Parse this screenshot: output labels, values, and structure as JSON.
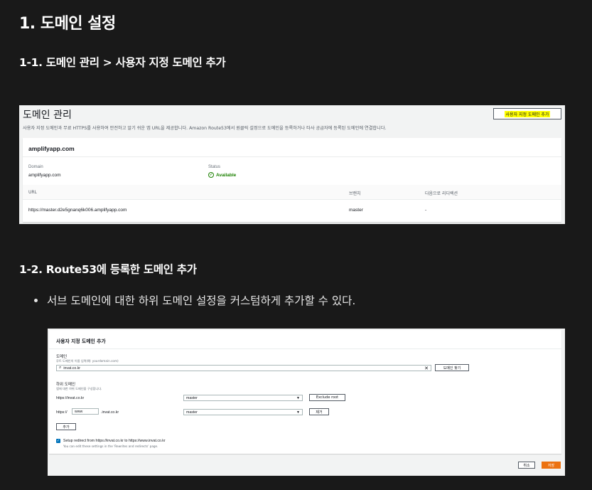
{
  "heading1": "1. 도메인 설정",
  "section1_title": "1-1. 도메인 관리 > 사용자 지정 도메인 추가",
  "section2_title": "1-2. Route53에 등록한 도메인 추가",
  "bullet_text": "서브 도메인에 대한 하위 도메인 설정을 커스텀하게 추가할 수 있다.",
  "domain_mgmt": {
    "title": "도메인 관리",
    "add_button": "사용자 지정 도메인 추가",
    "description": "사용자 지정 도메인과 무료 HTTPS를 사용하여 안전하고 알기 쉬운 앱 URL을 제공합니다. Amazon Route53에서 원클릭 설정으로 도메인을 등록하거나 타사 공급자에 등록된 도메인에 연결합니다.",
    "card_title": "amplifyapp.com",
    "domain_label": "Domain",
    "domain_value": "amplifyapp.com",
    "status_label": "Status",
    "status_value": "Available",
    "status_color": "#1d8102",
    "table": {
      "headers": [
        "URL",
        "브랜치",
        "다음으로 리디렉션"
      ],
      "row": [
        "https://master.d2e5gnanq6k006.amplifyapp.com",
        "master",
        "-"
      ]
    }
  },
  "add_domain": {
    "header": "사용자 지정 도메인 추가",
    "domain_label": "도메인",
    "domain_hint": "루트 도메인의 이름 입력(예: yourdomain.com)",
    "domain_value": "invat.co.kr",
    "find_button": "도메인 찾기",
    "subdomain_label": "하위 도메인",
    "subdomain_hint": "앱에 대한 하위 도메인을 구성합니다.",
    "rows": [
      {
        "prefix": "https://invat.co.kr",
        "input": "",
        "suffix": "",
        "branch": "master",
        "action": "Exclude root"
      },
      {
        "prefix": "https://",
        "input": "www",
        "suffix": ".invat.co.kr",
        "branch": "master",
        "action": "제거"
      }
    ],
    "add_button": "추가",
    "redirect_label": "Setup redirect from https://invat.co.kr to https://www.invat.co.kr",
    "redirect_hint": "You can edit these settings in the 'Rewrites and redirects' page.",
    "cancel_button": "취소",
    "save_button": "저장",
    "save_color": "#ec7211"
  }
}
